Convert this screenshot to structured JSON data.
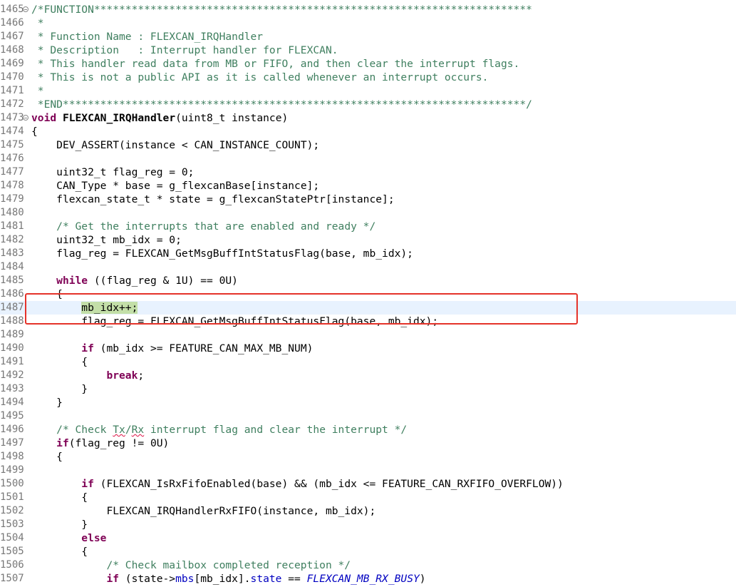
{
  "editor": {
    "lines": [
      {
        "n": "1465",
        "fold": true,
        "indent": "",
        "tokens": [
          {
            "c": "c",
            "t": "/*FUNCTION**********************************************************************"
          }
        ]
      },
      {
        "n": "1466",
        "indent": "",
        "tokens": [
          {
            "c": "c",
            "t": " *"
          }
        ]
      },
      {
        "n": "1467",
        "indent": "",
        "tokens": [
          {
            "c": "c",
            "t": " * Function Name : FLEXCAN_IRQHandler"
          }
        ]
      },
      {
        "n": "1468",
        "indent": "",
        "tokens": [
          {
            "c": "c",
            "t": " * Description   : Interrupt handler for FLEXCAN."
          }
        ]
      },
      {
        "n": "1469",
        "indent": "",
        "tokens": [
          {
            "c": "c",
            "t": " * This handler read data from MB or FIFO, and then clear the interrupt flags."
          }
        ]
      },
      {
        "n": "1470",
        "indent": "",
        "tokens": [
          {
            "c": "c",
            "t": " * This is not a public API as it is called whenever an interrupt occurs."
          }
        ]
      },
      {
        "n": "1471",
        "indent": "",
        "tokens": [
          {
            "c": "c",
            "t": " *"
          }
        ]
      },
      {
        "n": "1472",
        "indent": "",
        "tokens": [
          {
            "c": "c",
            "t": " *END**************************************************************************/"
          }
        ]
      },
      {
        "n": "1473",
        "fold": true,
        "indent": "",
        "tokens": [
          {
            "c": "kw",
            "t": "void"
          },
          {
            "c": "",
            "t": " "
          },
          {
            "c": "fn",
            "t": "FLEXCAN_IRQHandler"
          },
          {
            "c": "",
            "t": "(uint8_t instance)"
          }
        ]
      },
      {
        "n": "1474",
        "indent": "",
        "tokens": [
          {
            "c": "",
            "t": "{"
          }
        ]
      },
      {
        "n": "1475",
        "indent": "    ",
        "tokens": [
          {
            "c": "",
            "t": "DEV_ASSERT(instance < CAN_INSTANCE_COUNT);"
          }
        ]
      },
      {
        "n": "1476",
        "indent": "",
        "tokens": []
      },
      {
        "n": "1477",
        "indent": "    ",
        "tokens": [
          {
            "c": "",
            "t": "uint32_t flag_reg = 0;"
          }
        ]
      },
      {
        "n": "1478",
        "indent": "    ",
        "tokens": [
          {
            "c": "",
            "t": "CAN_Type * base = g_flexcanBase[instance];"
          }
        ]
      },
      {
        "n": "1479",
        "indent": "    ",
        "tokens": [
          {
            "c": "",
            "t": "flexcan_state_t * state = g_flexcanStatePtr[instance];"
          }
        ]
      },
      {
        "n": "1480",
        "indent": "",
        "tokens": []
      },
      {
        "n": "1481",
        "indent": "    ",
        "tokens": [
          {
            "c": "c",
            "t": "/* Get the interrupts that are enabled and ready */"
          }
        ]
      },
      {
        "n": "1482",
        "indent": "    ",
        "tokens": [
          {
            "c": "",
            "t": "uint32_t mb_idx = 0;"
          }
        ]
      },
      {
        "n": "1483",
        "indent": "    ",
        "tokens": [
          {
            "c": "",
            "t": "flag_reg = FLEXCAN_GetMsgBuffIntStatusFlag(base, mb_idx);"
          }
        ]
      },
      {
        "n": "1484",
        "indent": "",
        "tokens": []
      },
      {
        "n": "1485",
        "indent": "    ",
        "tokens": [
          {
            "c": "kw",
            "t": "while"
          },
          {
            "c": "",
            "t": " ((flag_reg & 1U) == 0U)"
          }
        ]
      },
      {
        "n": "1486",
        "indent": "    ",
        "tokens": [
          {
            "c": "",
            "t": "{"
          }
        ]
      },
      {
        "n": "1487",
        "current": true,
        "indent": "        ",
        "tokens": [
          {
            "c": "",
            "t": "mb_idx++;"
          }
        ]
      },
      {
        "n": "1488",
        "indent": "        ",
        "tokens": [
          {
            "c": "",
            "t": "flag_reg = FLEXCAN_GetMsgBuffIntStatusFlag(base, mb_idx);"
          }
        ]
      },
      {
        "n": "1489",
        "indent": "",
        "tokens": []
      },
      {
        "n": "1490",
        "indent": "        ",
        "tokens": [
          {
            "c": "kw",
            "t": "if"
          },
          {
            "c": "",
            "t": " (mb_idx >= FEATURE_CAN_MAX_MB_NUM)"
          }
        ]
      },
      {
        "n": "1491",
        "indent": "        ",
        "tokens": [
          {
            "c": "",
            "t": "{"
          }
        ]
      },
      {
        "n": "1492",
        "indent": "            ",
        "tokens": [
          {
            "c": "kw",
            "t": "break"
          },
          {
            "c": "",
            "t": ";"
          }
        ]
      },
      {
        "n": "1493",
        "indent": "        ",
        "tokens": [
          {
            "c": "",
            "t": "}"
          }
        ]
      },
      {
        "n": "1494",
        "indent": "    ",
        "tokens": [
          {
            "c": "",
            "t": "}"
          }
        ]
      },
      {
        "n": "1495",
        "indent": "",
        "tokens": []
      },
      {
        "n": "1496",
        "indent": "    ",
        "tokens": [
          {
            "c": "c",
            "t": "/* Check "
          },
          {
            "c": "c sq",
            "t": "Tx"
          },
          {
            "c": "c",
            "t": "/"
          },
          {
            "c": "c sq",
            "t": "Rx"
          },
          {
            "c": "c",
            "t": " interrupt flag and clear the interrupt */"
          }
        ]
      },
      {
        "n": "1497",
        "indent": "    ",
        "tokens": [
          {
            "c": "kw",
            "t": "if"
          },
          {
            "c": "",
            "t": "(flag_reg != 0U)"
          }
        ]
      },
      {
        "n": "1498",
        "indent": "    ",
        "tokens": [
          {
            "c": "",
            "t": "{"
          }
        ]
      },
      {
        "n": "1499",
        "indent": "",
        "tokens": []
      },
      {
        "n": "1500",
        "indent": "        ",
        "tokens": [
          {
            "c": "kw",
            "t": "if"
          },
          {
            "c": "",
            "t": " (FLEXCAN_IsRxFifoEnabled(base) && (mb_idx <= FEATURE_CAN_RXFIFO_OVERFLOW))"
          }
        ]
      },
      {
        "n": "1501",
        "indent": "        ",
        "tokens": [
          {
            "c": "",
            "t": "{"
          }
        ]
      },
      {
        "n": "1502",
        "indent": "            ",
        "tokens": [
          {
            "c": "",
            "t": "FLEXCAN_IRQHandlerRxFIFO(instance, mb_idx);"
          }
        ]
      },
      {
        "n": "1503",
        "indent": "        ",
        "tokens": [
          {
            "c": "",
            "t": "}"
          }
        ]
      },
      {
        "n": "1504",
        "indent": "        ",
        "tokens": [
          {
            "c": "kw",
            "t": "else"
          }
        ]
      },
      {
        "n": "1505",
        "indent": "        ",
        "tokens": [
          {
            "c": "",
            "t": "{"
          }
        ]
      },
      {
        "n": "1506",
        "indent": "            ",
        "tokens": [
          {
            "c": "c",
            "t": "/* Check mailbox completed reception */"
          }
        ]
      },
      {
        "n": "1507",
        "indent": "            ",
        "tokens": [
          {
            "c": "kw",
            "t": "if"
          },
          {
            "c": "",
            "t": " (state->"
          },
          {
            "c": "fld",
            "t": "mbs"
          },
          {
            "c": "",
            "t": "[mb_idx]."
          },
          {
            "c": "fld",
            "t": "state"
          },
          {
            "c": "",
            "t": " == "
          },
          {
            "c": "en",
            "t": "FLEXCAN_MB_RX_BUSY"
          },
          {
            "c": "",
            "t": ")"
          }
        ]
      }
    ]
  },
  "colors": {
    "comment": "#3f7f5f",
    "keyword": "#7f0055",
    "field": "#0000c0",
    "current_line": "#e8f2fe",
    "occurrence_highlight": "#c3dfa8",
    "annotation_box": "#e5332a"
  }
}
